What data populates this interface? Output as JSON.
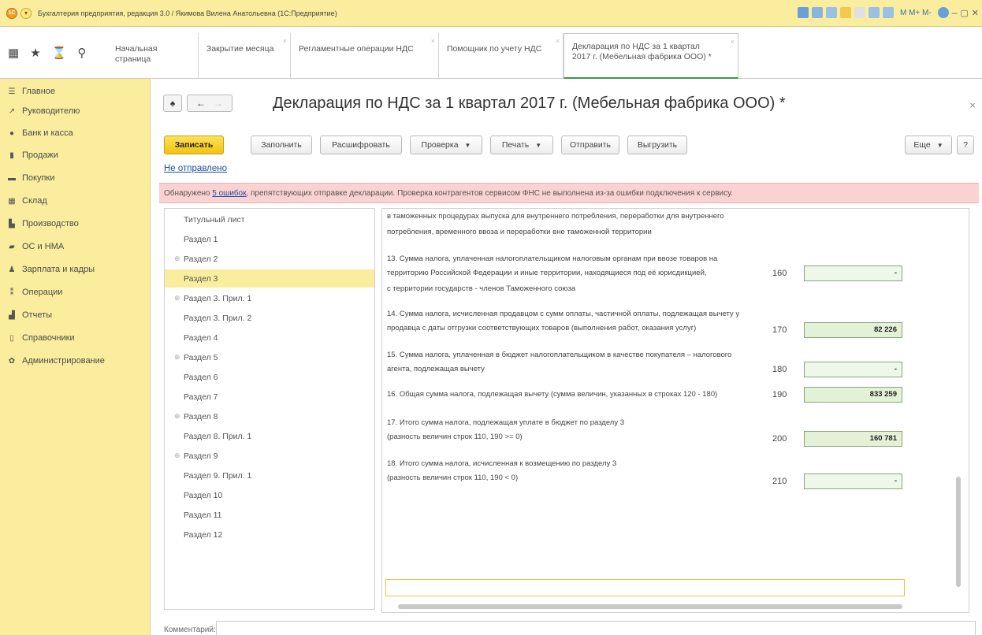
{
  "window": {
    "title": "Бухгалтерия предприятия, редакция 3.0 / Якимова Вилена Анатольевна (1С:Предприятие)",
    "toolbar_text": "M  M+  M-"
  },
  "tabs": [
    {
      "label": "Начальная страница"
    },
    {
      "label": "Закрытие месяца"
    },
    {
      "label": "Регламентные операции НДС"
    },
    {
      "label": "Помощник по учету НДС"
    },
    {
      "label_line1": "Декларация по НДС за 1 квартал",
      "label_line2": "2017 г. (Мебельная фабрика ООО) *"
    }
  ],
  "sidebar": {
    "items": [
      {
        "label": "Главное",
        "icon": "☰"
      },
      {
        "label": "Руководителю",
        "icon": "↗"
      },
      {
        "label": "Банк и касса",
        "icon": "●"
      },
      {
        "label": "Продажи",
        "icon": "▮"
      },
      {
        "label": "Покупки",
        "icon": "▬"
      },
      {
        "label": "Склад",
        "icon": "▦"
      },
      {
        "label": "Производство",
        "icon": "▙"
      },
      {
        "label": "ОС и НМА",
        "icon": "▰"
      },
      {
        "label": "Зарплата и кадры",
        "icon": "♟"
      },
      {
        "label": "Операции",
        "icon": "⁑"
      },
      {
        "label": "Отчеты",
        "icon": "▟"
      },
      {
        "label": "Справочники",
        "icon": "▯"
      },
      {
        "label": "Администрирование",
        "icon": "✿"
      }
    ]
  },
  "header": {
    "home": "♠",
    "back": "←",
    "forward": "→",
    "title": "Декларация по НДС за 1 квартал 2017 г. (Мебельная фабрика ООО) *",
    "close": "×"
  },
  "toolbar": {
    "save": "Записать",
    "fill": "Заполнить",
    "decode": "Расшифровать",
    "check": "Проверка",
    "print": "Печать",
    "send": "Отправить",
    "export": "Выгрузить",
    "more": "Еще",
    "help": "?"
  },
  "status": {
    "link": "Не отправлено",
    "warning_prefix": "Обнаружено ",
    "warning_link": "5 ошибок",
    "warning_suffix": ", препятствующих отправке декларации. Проверка контрагентов сервисом ФНС не выполнена из-за ошибки подключения к сервису."
  },
  "sections": [
    {
      "label": "Титульный лист",
      "expandable": false
    },
    {
      "label": "Раздел 1",
      "expandable": false
    },
    {
      "label": "Раздел 2",
      "expandable": true
    },
    {
      "label": "Раздел 3",
      "expandable": false,
      "selected": true
    },
    {
      "label": "Раздел 3. Прил. 1",
      "expandable": true
    },
    {
      "label": "Раздел 3. Прил. 2",
      "expandable": false
    },
    {
      "label": "Раздел 4",
      "expandable": false
    },
    {
      "label": "Раздел 5",
      "expandable": true
    },
    {
      "label": "Раздел 6",
      "expandable": false
    },
    {
      "label": "Раздел 7",
      "expandable": false
    },
    {
      "label": "Раздел 8",
      "expandable": true
    },
    {
      "label": "Раздел 8. Прил. 1",
      "expandable": false
    },
    {
      "label": "Раздел 9",
      "expandable": true
    },
    {
      "label": "Раздел 9. Прил. 1",
      "expandable": false
    },
    {
      "label": "Раздел 10",
      "expandable": false
    },
    {
      "label": "Раздел 11",
      "expandable": false
    },
    {
      "label": "Раздел 12",
      "expandable": false
    }
  ],
  "form": {
    "intro_lines": [
      "в таможенных процедурах выпуска для внутреннего потребления, переработки для внутреннего",
      "потребления, временного ввоза и переработки вне таможенной территории"
    ],
    "rows": [
      {
        "lines": [
          "13. Сумма налога, уплаченная налогоплательщиком налоговым органам при ввозе товаров на",
          "территорию Российской Федерации и иные территории, находящиеся под её юрисдикцией,",
          "с территории государств - членов Таможенного союза"
        ],
        "code": "160",
        "value": "-"
      },
      {
        "lines": [
          "14. Сумма налога, исчисленная продавцом с сумм оплаты, частичной оплаты, подлежащая вычету у",
          "продавца с даты отгрузки соответствующих товаров (выполнения работ, оказания услуг)"
        ],
        "code": "170",
        "value": "82 226"
      },
      {
        "lines": [
          "15. Сумма налога, уплаченная в бюджет налогоплательщиком в качестве покупателя – налогового",
          "агента, подлежащая вычету"
        ],
        "code": "180",
        "value": "-"
      },
      {
        "lines": [
          "16. Общая сумма налога, подлежащая вычету (сумма величин, указанных в строках 120 - 180)"
        ],
        "code": "190",
        "value": "833 259"
      },
      {
        "lines": [
          "17. Итого сумма налога, подлежащая уплате в бюджет по разделу 3",
          "(разность величин строк 110, 190 >= 0)"
        ],
        "code": "200",
        "value": "160 781"
      },
      {
        "lines": [
          "18. Итого сумма налога, исчисленная к возмещению по разделу 3",
          "(разность величин строк 110, 190 < 0)"
        ],
        "code": "210",
        "value": "-"
      }
    ]
  },
  "comment": {
    "label": "Комментарий:"
  },
  "colors": {
    "accent_yellow": "#fbed9e",
    "warning_bg": "#fbd2d2",
    "field_green": "#e3f2d6",
    "active_tab": "#3a9a45"
  }
}
